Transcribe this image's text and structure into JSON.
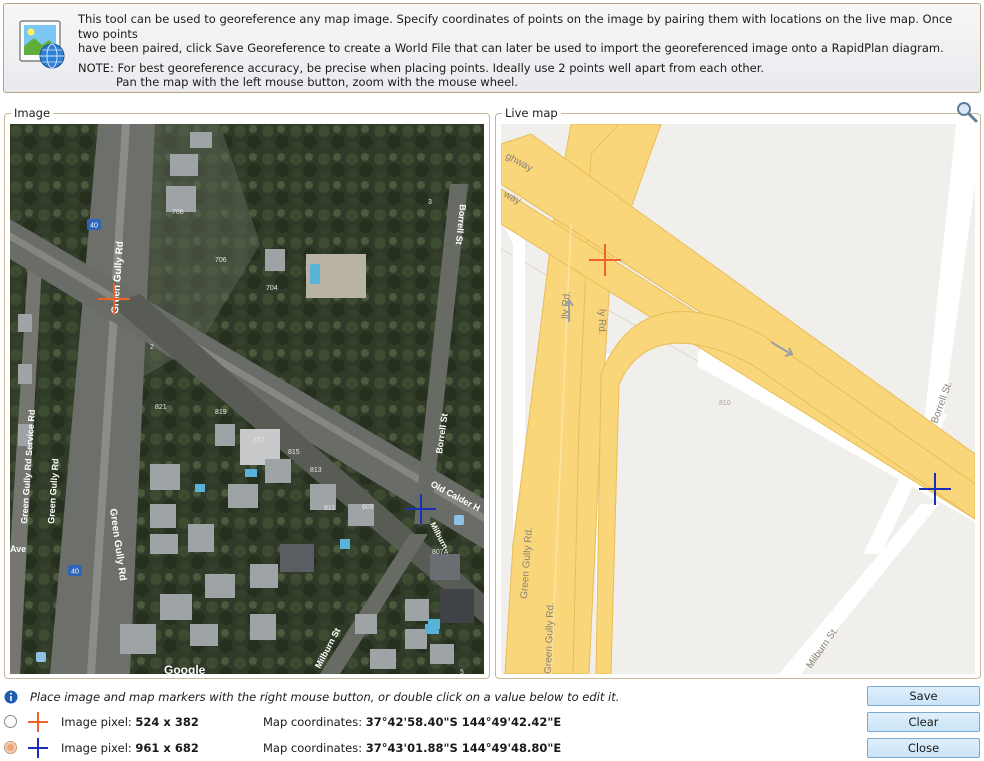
{
  "info": {
    "line1": "This tool can be used to georeference any map image. Specify coordinates of points on the image by pairing them with locations on the live map. Once two points",
    "line2": "have been paired, click Save Georeference to create a World File that can later be used to import the georeferenced image onto a RapidPlan diagram.",
    "line3": "NOTE: For best georeference accuracy, be precise when placing points. Ideally use 2 points well apart from each other.",
    "line4": "Pan the map with the left mouse button, zoom with the mouse wheel."
  },
  "image_panel": {
    "title": "Image",
    "labels": {
      "road_main_1": "Green Gully Rd",
      "road_main_2": "Green Gully Rd",
      "road_service": "Green Gully Rd Service Rd",
      "road_ave": "Ave",
      "road_borrell": "Borrell St",
      "road_old_calder": "Old Calder H",
      "road_milburn_1": "Milburn",
      "road_milburn_2": "Milburn St",
      "shield_1": "40",
      "shield_2": "40",
      "lot_708": "708",
      "lot_706": "706",
      "lot_704": "704",
      "lot_821": "821",
      "lot_819": "819",
      "lot_817": "817",
      "lot_815": "815",
      "lot_813": "813",
      "lot_811": "811",
      "lot_809": "809",
      "lot_807": "807A",
      "lot_3": "3",
      "lot_2": "2",
      "lot_5": "5",
      "watermark": "Google"
    }
  },
  "map_panel": {
    "title": "Live map",
    "labels": {
      "highway_1": "ghway",
      "highway_2": "way",
      "gully_1": "lly Rd.",
      "gully_2": "ly Rd.",
      "gully_3": "Green Gully Rd.",
      "gully_4": "Green Gully Rd.",
      "borrell": "Borrell St.",
      "milburn": "Milburn St.",
      "lot_810": "810"
    }
  },
  "hint": "Place image and map markers with the right mouse button, or double click on a value below to edit it.",
  "points": [
    {
      "pixel_label": "Image pixel:",
      "pixel_value": "524 x 382",
      "coord_label": "Map coordinates:",
      "coord_value": "37°42'58.40\"S 144°49'42.42\"E",
      "color": "#f0622a",
      "selected": false
    },
    {
      "pixel_label": "Image pixel:",
      "pixel_value": "961 x 682",
      "coord_label": "Map coordinates:",
      "coord_value": "37°43'01.88\"S 144°49'48.80\"E",
      "color": "#1a2fb8",
      "selected": true
    }
  ],
  "buttons": {
    "save": "Save",
    "clear": "Clear",
    "close": "Close"
  },
  "icons": {
    "logo": "georeference-globe-icon",
    "zoom": "magnifier-icon",
    "info": "info-icon"
  },
  "colors": {
    "marker1": "#f0622a",
    "marker2": "#1a2fb8",
    "road_yellow": "#f9d67a",
    "panel_border": "#c9b89b"
  }
}
